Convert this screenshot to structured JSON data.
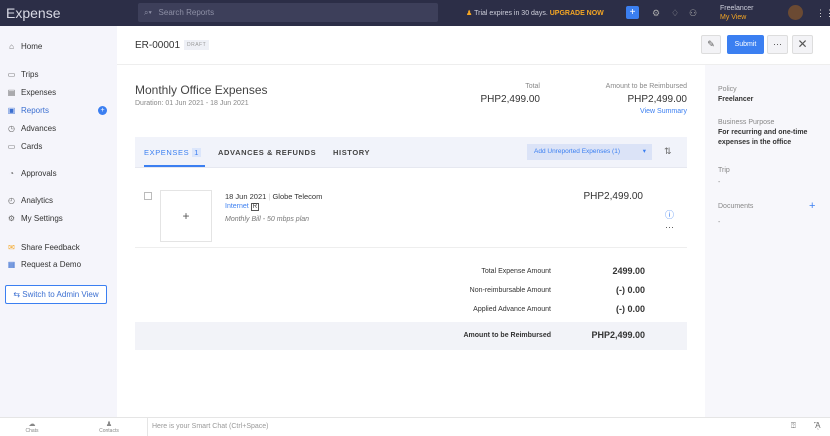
{
  "app": {
    "title": "Expense",
    "search_placeholder": "Search Reports",
    "trial_text": "Trial expires in 30 days.",
    "upgrade": "UPGRADE NOW",
    "user_name": "Freelancer",
    "user_view": "My View"
  },
  "sidebar": {
    "items": [
      {
        "label": "Home",
        "icon": "⌂"
      },
      {
        "label": "Trips",
        "icon": "▭"
      },
      {
        "label": "Expenses",
        "icon": "▤"
      },
      {
        "label": "Reports",
        "icon": "▣"
      },
      {
        "label": "Advances",
        "icon": "◷"
      },
      {
        "label": "Cards",
        "icon": "▭"
      },
      {
        "label": "Approvals",
        "icon": "◔"
      },
      {
        "label": "Analytics",
        "icon": "◴"
      },
      {
        "label": "My Settings",
        "icon": "⚙"
      },
      {
        "label": "Share Feedback",
        "icon": "✉"
      },
      {
        "label": "Request a Demo",
        "icon": "▦"
      }
    ],
    "admin_button": "Switch to Admin View"
  },
  "report": {
    "id": "ER-00001",
    "status": "DRAFT",
    "submit": "Submit",
    "name": "Monthly Office Expenses",
    "duration": "Duration: 01 Jun 2021 - 18 Jun 2021",
    "total_label": "Total",
    "total": "PHP2,499.00",
    "reimb_label": "Amount to be Reimbursed",
    "reimb": "PHP2,499.00",
    "view_summary": "View Summary"
  },
  "tabs": [
    {
      "label": "EXPENSES",
      "count": "1"
    },
    {
      "label": "ADVANCES & REFUNDS"
    },
    {
      "label": "HISTORY"
    }
  ],
  "add_unreported": "Add Unreported Expenses (1)",
  "expense": {
    "date": "18 Jun 2021",
    "merchant": "Globe Telecom",
    "category": "Internet",
    "flag": "R",
    "description": "Monthly Bill - 50 mbps plan",
    "amount": "PHP2,499.00"
  },
  "summary": [
    {
      "label": "Total Expense Amount",
      "value": "2499.00"
    },
    {
      "label": "Non-reimbursable Amount",
      "value": "(-) 0.00"
    },
    {
      "label": "Applied Advance Amount",
      "value": "(-) 0.00"
    },
    {
      "label": "Amount to be Reimbursed",
      "value": "PHP2,499.00"
    }
  ],
  "details": {
    "policy_label": "Policy",
    "policy": "Freelancer",
    "purpose_label": "Business Purpose",
    "purpose": "For recurring and one-time expenses in the office",
    "trip_label": "Trip",
    "trip": "-",
    "docs_label": "Documents",
    "docs": "-"
  },
  "bottom": {
    "chats": "Chats",
    "contacts": "Contacts",
    "chat_placeholder": "Here is your Smart Chat (Ctrl+Space)"
  }
}
